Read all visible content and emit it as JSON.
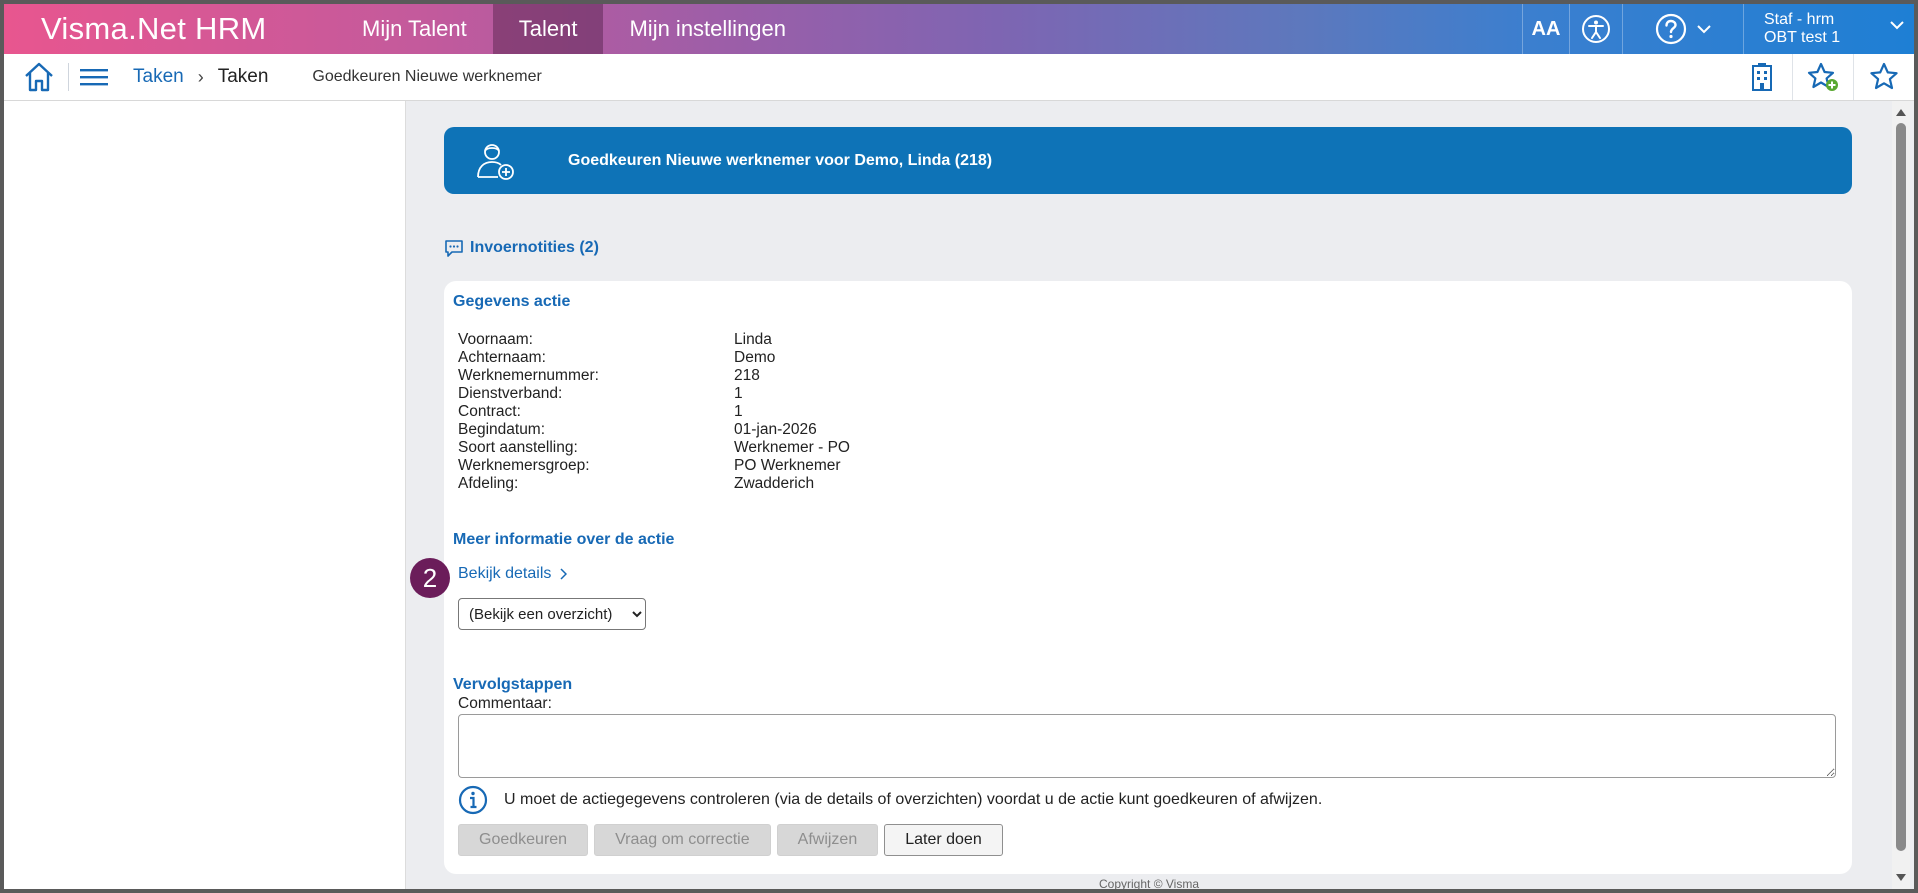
{
  "app": {
    "brand": "Visma.Net HRM"
  },
  "topnav": {
    "tabs": [
      {
        "label": "Mijn Talent",
        "active": false
      },
      {
        "label": "Talent",
        "active": true
      },
      {
        "label": "Mijn instellingen",
        "active": false
      }
    ],
    "font_size_icon": "AA",
    "user": {
      "line1": "Staf - hrm",
      "line2": "OBT test 1"
    }
  },
  "breadcrumb": {
    "link": "Taken",
    "separator": "›",
    "current": "Taken",
    "subtitle": "Goedkeuren Nieuwe werknemer"
  },
  "banner": {
    "title": "Goedkeuren Nieuwe werknemer voor Demo, Linda (218)"
  },
  "notes": {
    "label": "Invoernotities (2)"
  },
  "gegevens": {
    "title": "Gegevens actie",
    "rows": [
      {
        "label": "Voornaam:",
        "value": "Linda"
      },
      {
        "label": "Achternaam:",
        "value": "Demo"
      },
      {
        "label": "Werknemernummer:",
        "value": "218"
      },
      {
        "label": "Dienstverband:",
        "value": "1"
      },
      {
        "label": "Contract:",
        "value": "1"
      },
      {
        "label": "Begindatum:",
        "value": "01-jan-2026"
      },
      {
        "label": "Soort aanstelling:",
        "value": "Werknemer - PO"
      },
      {
        "label": "Werknemersgroep:",
        "value": "PO Werknemer"
      },
      {
        "label": "Afdeling:",
        "value": "Zwadderich"
      }
    ]
  },
  "meer": {
    "title": "Meer informatie over de actie",
    "link": "Bekijk details",
    "badge": "2",
    "select_value": "(Bekijk een overzicht)"
  },
  "vervolg": {
    "title": "Vervolgstappen",
    "comment_label": "Commentaar:",
    "info_text": "U moet de actiegegevens controleren (via de details of overzichten) voordat u de actie kunt goedkeuren of afwijzen.",
    "buttons": {
      "approve": "Goedkeuren",
      "correction": "Vraag om correctie",
      "reject": "Afwijzen",
      "later": "Later doen"
    }
  },
  "footer": {
    "copyright": "Copyright © Visma"
  },
  "colors": {
    "brand_blue": "#0e73b7",
    "link_blue": "#1769b5",
    "badge": "#6b1d5a"
  }
}
